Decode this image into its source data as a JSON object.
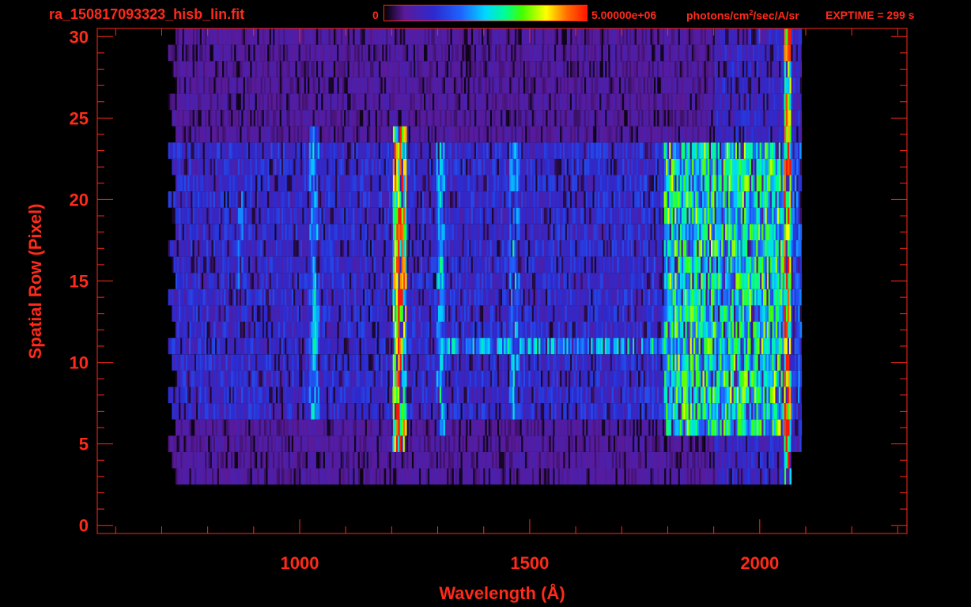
{
  "header": {
    "filename": "ra_150817093323_hisb_lin.fit",
    "colorbar_min": "0",
    "colorbar_max": "5.00000e+06",
    "units_prefix": "photons/cm",
    "units_sup": "2",
    "units_suffix": "/sec/A/sr",
    "exptime": "EXPTIME = 299 s"
  },
  "colors": {
    "axis": "#ff2a1a",
    "background": "#000000"
  },
  "chart_data": {
    "type": "heatmap",
    "title": "ra_150817093323_hisb_lin.fit",
    "xlabel": "Wavelength (Å)",
    "ylabel": "Spatial Row (Pixel)",
    "xlim": [
      560,
      2320
    ],
    "ylim": [
      -0.5,
      30.5
    ],
    "x_ticks": [
      1000,
      1500,
      2000
    ],
    "y_ticks": [
      0,
      5,
      10,
      15,
      20,
      25,
      30
    ],
    "colorbar": {
      "min": 0,
      "max": 5000000,
      "units": "photons/cm^2/sec/A/sr",
      "scale": "linear"
    },
    "grid": false,
    "data_extent": {
      "x": [
        730,
        2090
      ],
      "y": [
        3,
        30
      ]
    },
    "features": [
      {
        "name": "bright line",
        "x": 1215,
        "rows": [
          5,
          24
        ],
        "level": "high"
      },
      {
        "name": "line",
        "x": 1030,
        "rows": [
          7,
          24
        ],
        "level": "medium"
      },
      {
        "name": "line",
        "x": 1305,
        "rows": [
          6,
          23
        ],
        "level": "medium"
      },
      {
        "name": "line",
        "x": 1465,
        "rows": [
          7,
          23
        ],
        "level": "medium"
      },
      {
        "name": "band",
        "x_range": [
          1790,
          2060
        ],
        "rows": [
          6,
          23
        ],
        "level": "medium-high"
      },
      {
        "name": "bright row",
        "x_range": [
          1310,
          2060
        ],
        "rows": [
          11,
          11
        ],
        "level": "medium"
      },
      {
        "name": "faint arc",
        "x": 870,
        "rows": [
          15,
          20
        ],
        "level": "low-medium"
      }
    ]
  }
}
